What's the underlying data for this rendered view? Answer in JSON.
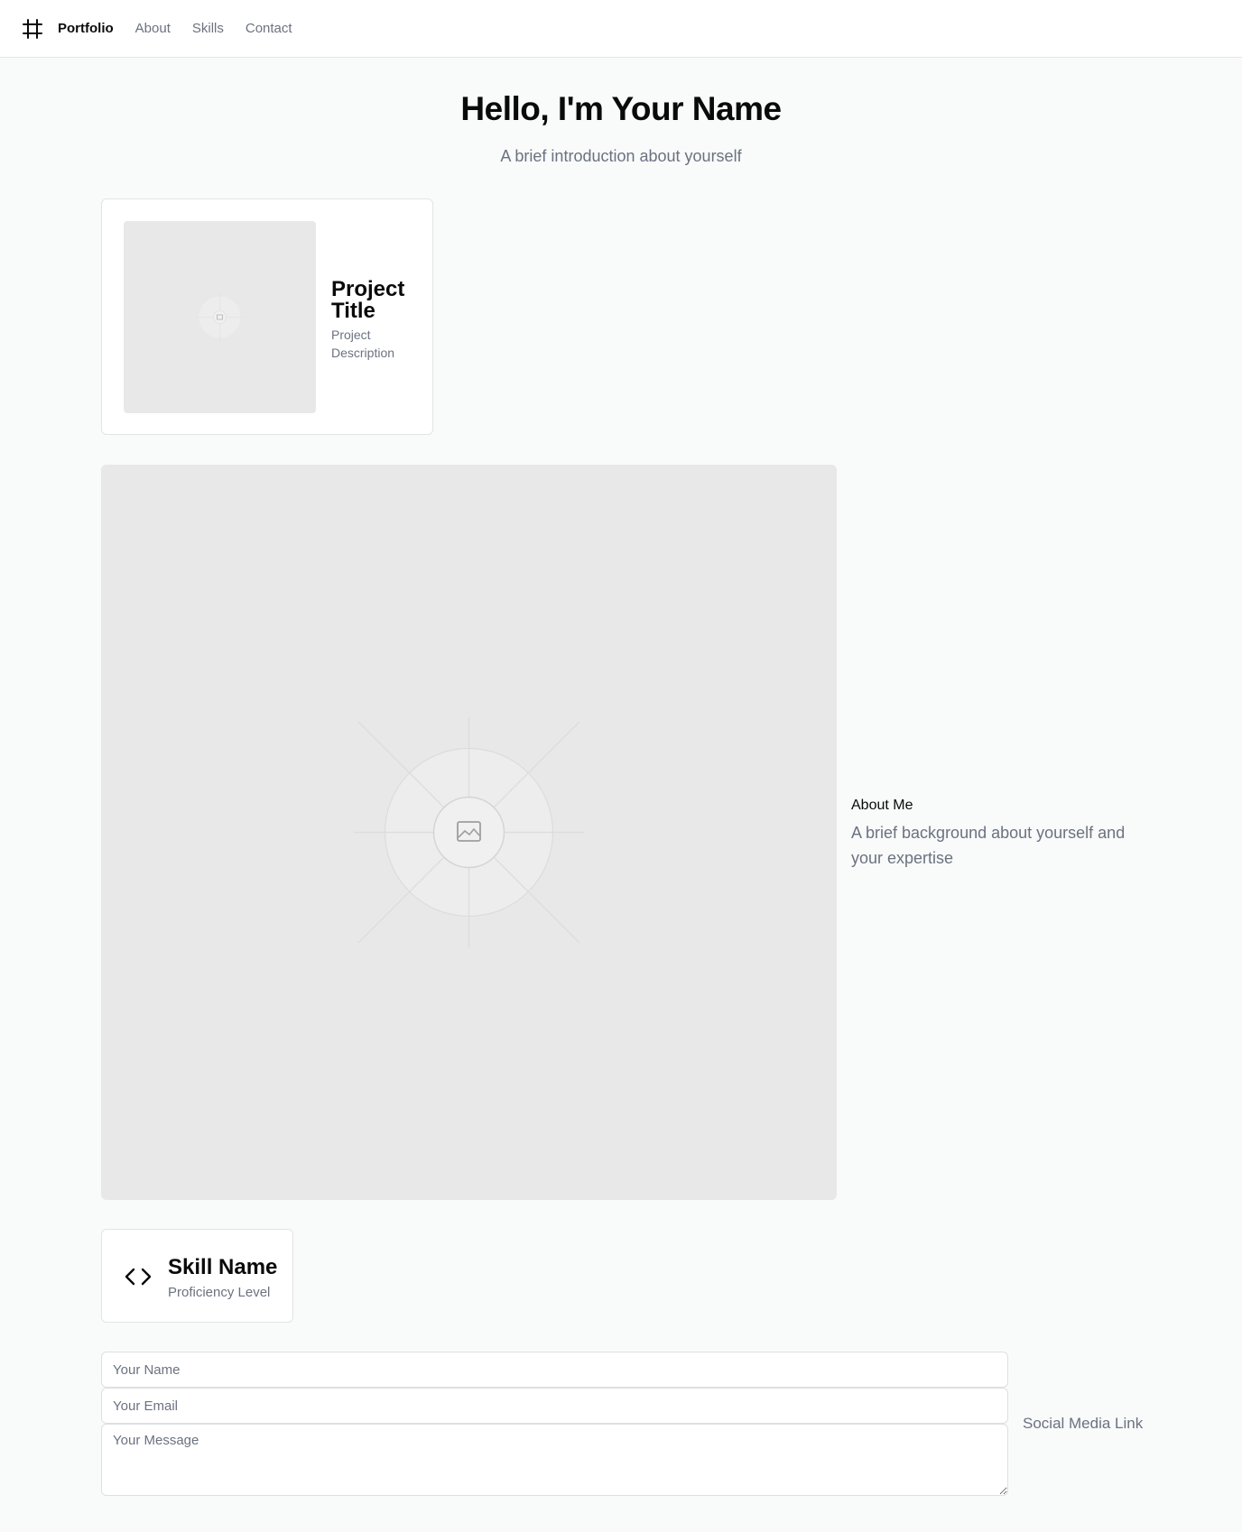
{
  "header": {
    "brand": "Portfolio",
    "nav": [
      "About",
      "Skills",
      "Contact"
    ]
  },
  "hero": {
    "title": "Hello, I'm Your Name",
    "subtitle": "A brief introduction about yourself"
  },
  "project": {
    "title": "Project Title",
    "description": "Project Description"
  },
  "about": {
    "heading": "About Me",
    "text": "A brief background about yourself and your expertise"
  },
  "skill": {
    "name": "Skill Name",
    "level": "Proficiency Level"
  },
  "contact": {
    "name_placeholder": "Your Name",
    "email_placeholder": "Your Email",
    "message_placeholder": "Your Message",
    "social_link": "Social Media Link"
  },
  "icons": {
    "logo": "frame-icon",
    "placeholder": "image-placeholder-icon",
    "skill": "code-icon"
  },
  "colors": {
    "background": "#f9fafa",
    "surface": "#ffffff",
    "muted_text": "#6b7280",
    "placeholder_fill": "#e8e8e8"
  }
}
